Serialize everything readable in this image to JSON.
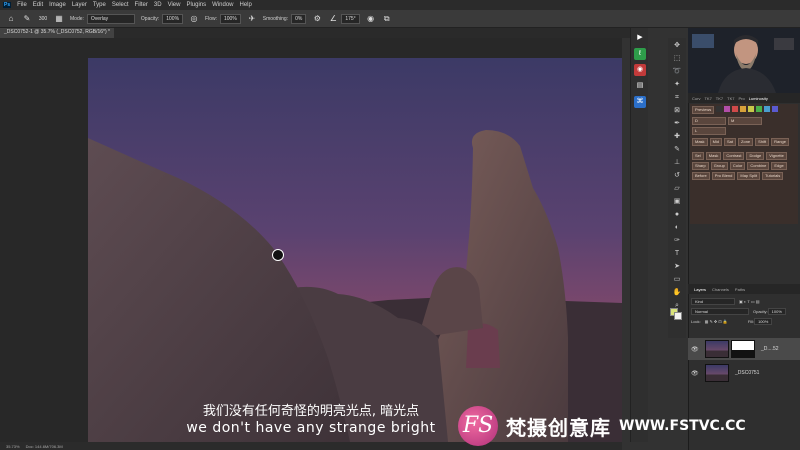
{
  "menu": [
    "File",
    "Edit",
    "Image",
    "Layer",
    "Type",
    "Select",
    "Filter",
    "3D",
    "View",
    "Plugins",
    "Window",
    "Help"
  ],
  "options": {
    "brush_size": "300",
    "mode_label": "Mode:",
    "mode_value": "Overlay",
    "opacity_label": "Opacity:",
    "opacity_value": "100%",
    "flow_label": "Flow:",
    "flow_value": "100%",
    "smoothing_label": "Smoothing:",
    "smoothing_value": "0%",
    "angle_value": "175°"
  },
  "document_tab": "_DSC0752-1 @ 35.7% (_DSC0752, RGB/16*) *",
  "status": {
    "zoom": "35.73%",
    "doc": "Doc: 144.6M/706.3M"
  },
  "luminosity_tabs": [
    "Curv",
    "TK7",
    "TK7",
    "TK7",
    "Pro",
    "Luminosity"
  ],
  "luminosity_buttons": [
    "Previews",
    "D",
    "M",
    "L",
    "Mask",
    "Mid",
    "Sat",
    "Zone",
    "Shift",
    "Range",
    "Sel",
    "Mask",
    "Contrast",
    "Dodge",
    "Vignette",
    "Sharp",
    "Group",
    "Color",
    "Combine",
    "Edge",
    "Before",
    "Pro Blend",
    "Map Split",
    "Tutorials"
  ],
  "layers": {
    "tabs": [
      "Layers",
      "Channels",
      "Paths"
    ],
    "kind_label": "Kind",
    "blend_mode": "Normal",
    "opacity_label": "Opacity:",
    "opacity_value": "100%",
    "lock_label": "Lock:",
    "fill_label": "Fill:",
    "fill_value": "100%",
    "items": [
      {
        "name": "_D....52"
      },
      {
        "name": "_DSC0751"
      }
    ]
  },
  "subtitle": {
    "cn": "我们没有任何奇怪的明亮光点, 暗光点",
    "en": "we don't have any strange bright"
  },
  "watermark": {
    "logo": "FS",
    "cn": "梵摄创意库",
    "url": "WWW.FSTVC.CC"
  },
  "colors": {
    "sky_top": "#4a3f6b",
    "sky_glow": "#e05a5a",
    "rock": "#6a544e",
    "accent": "#31a8ff"
  }
}
